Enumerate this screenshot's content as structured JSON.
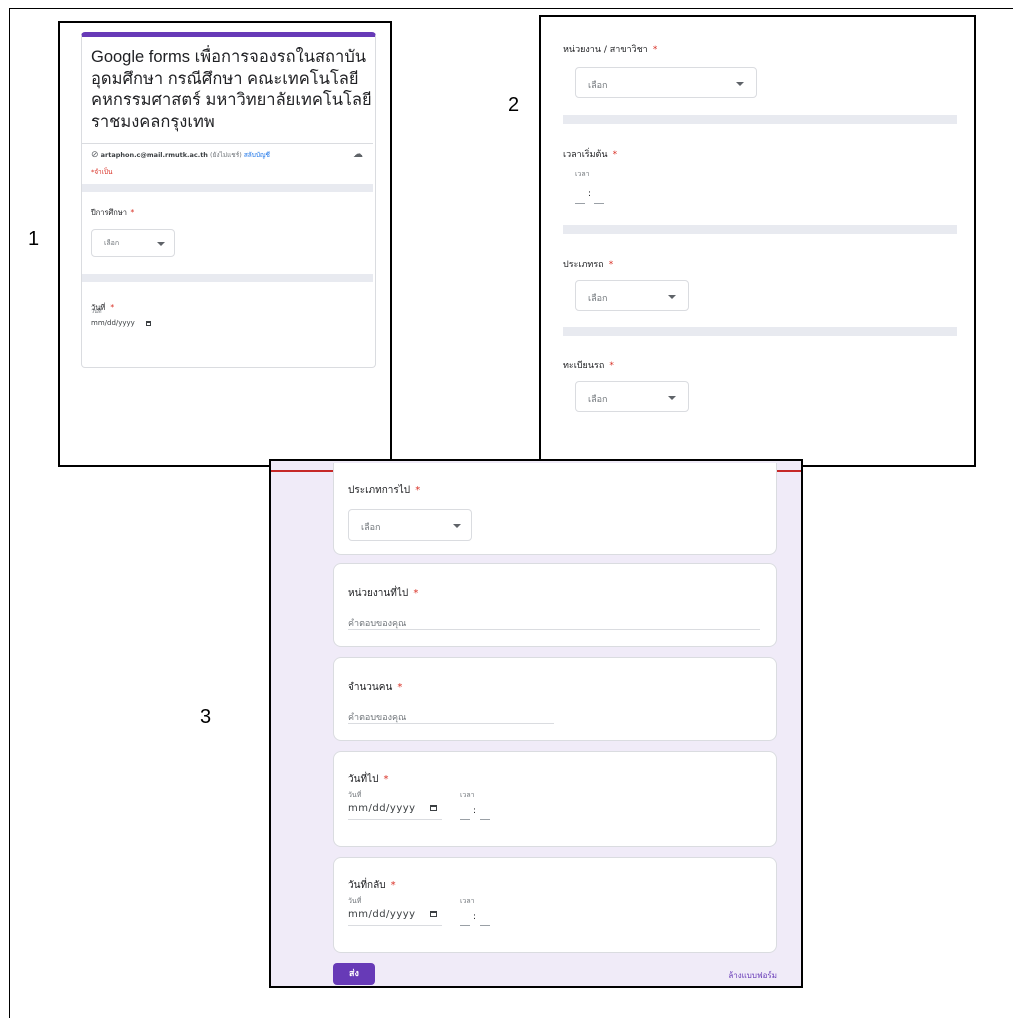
{
  "labels": {
    "one": "1",
    "two": "2",
    "three": "3"
  },
  "panel1": {
    "title": "Google forms เพื่อการจองรถในสถาบันอุดมศึกษา กรณีศึกษา คณะเทคโนโลยีคหกรรมศาสตร์ มหาวิทยาลัยเทคโนโลยีราชมงคลกรุงเทพ",
    "account_email": "artaphon.c@mail.rmutk.ac.th",
    "account_note": "(ยังไม่แชร์)",
    "switch_account": "สลับบัญชี",
    "required_note": "*จำเป็น",
    "q_year": "ปีการศึกษา",
    "choose": "เลือก",
    "q_date": "วันที่",
    "date_sub": "วันที่",
    "date_placeholder": "mm/dd/yyyy"
  },
  "panel2": {
    "q_dept": "หน่วยงาน / สาขาวิชา",
    "choose": "เลือก",
    "q_start_time": "เวลาเริ่มต้น",
    "time_sub": "เวลา",
    "time_sep": ":",
    "q_car_type": "ประเภทรถ",
    "q_plate": "ทะเบียนรถ"
  },
  "panel3": {
    "q_trip_type": "ประเภทการไป",
    "choose": "เลือก",
    "q_destination": "หน่วยงานที่ไป",
    "answer_placeholder": "คำตอบของคุณ",
    "q_people": "จำนวนคน",
    "q_depart_date": "วันที่ไป",
    "date_sub": "วันที่",
    "time_sub": "เวลา",
    "date_placeholder": "mm/dd/yyyy",
    "time_sep": ":",
    "q_return_date": "วันที่กลับ",
    "submit": "ส่ง",
    "clear": "ล้างแบบฟอร์ม"
  },
  "required_mark": "*",
  "colors": {
    "accent": "#673ab7",
    "required": "#d93025",
    "band": "#e8eaf0",
    "panel3_top": "#c62828"
  }
}
